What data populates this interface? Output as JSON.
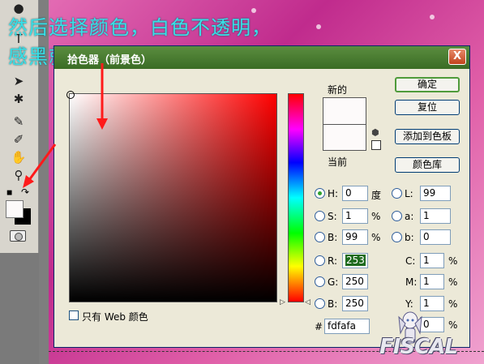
{
  "overlay": {
    "line1": "然后选择颜色，白色不透明，",
    "line2": "感黑就是成栈透明"
  },
  "dialog": {
    "title": "拾色器（前景色）",
    "close": "X",
    "new_label": "新的",
    "current_label": "当前",
    "buttons": {
      "ok": "确定",
      "reset": "复位",
      "add_swatch": "添加到色板",
      "color_library": "颜色库"
    },
    "web_only_label": "只有 Web 颜色",
    "hsb": [
      {
        "label": "H:",
        "value": "0",
        "unit": "度"
      },
      {
        "label": "S:",
        "value": "1",
        "unit": "%"
      },
      {
        "label": "B:",
        "value": "99",
        "unit": "%"
      }
    ],
    "rgb": [
      {
        "label": "R:",
        "value": "253"
      },
      {
        "label": "G:",
        "value": "250"
      },
      {
        "label": "B:",
        "value": "250"
      }
    ],
    "lab": [
      {
        "label": "L:",
        "value": "99"
      },
      {
        "label": "a:",
        "value": "1"
      },
      {
        "label": "b:",
        "value": "0"
      }
    ],
    "cmyk": [
      {
        "label": "C:",
        "value": "1",
        "unit": "%"
      },
      {
        "label": "M:",
        "value": "1",
        "unit": "%"
      },
      {
        "label": "Y:",
        "value": "1",
        "unit": "%"
      },
      {
        "label": "K:",
        "value": "0",
        "unit": "%"
      }
    ],
    "hex_label": "#",
    "hex_value": "fdfafa"
  },
  "watermark": "FISCAL",
  "colors": {
    "selected_color": "#fdfafa",
    "title_bar": "#4a7d30",
    "overlay_text": "#38e0e8",
    "arrow": "#ff1a1a"
  }
}
